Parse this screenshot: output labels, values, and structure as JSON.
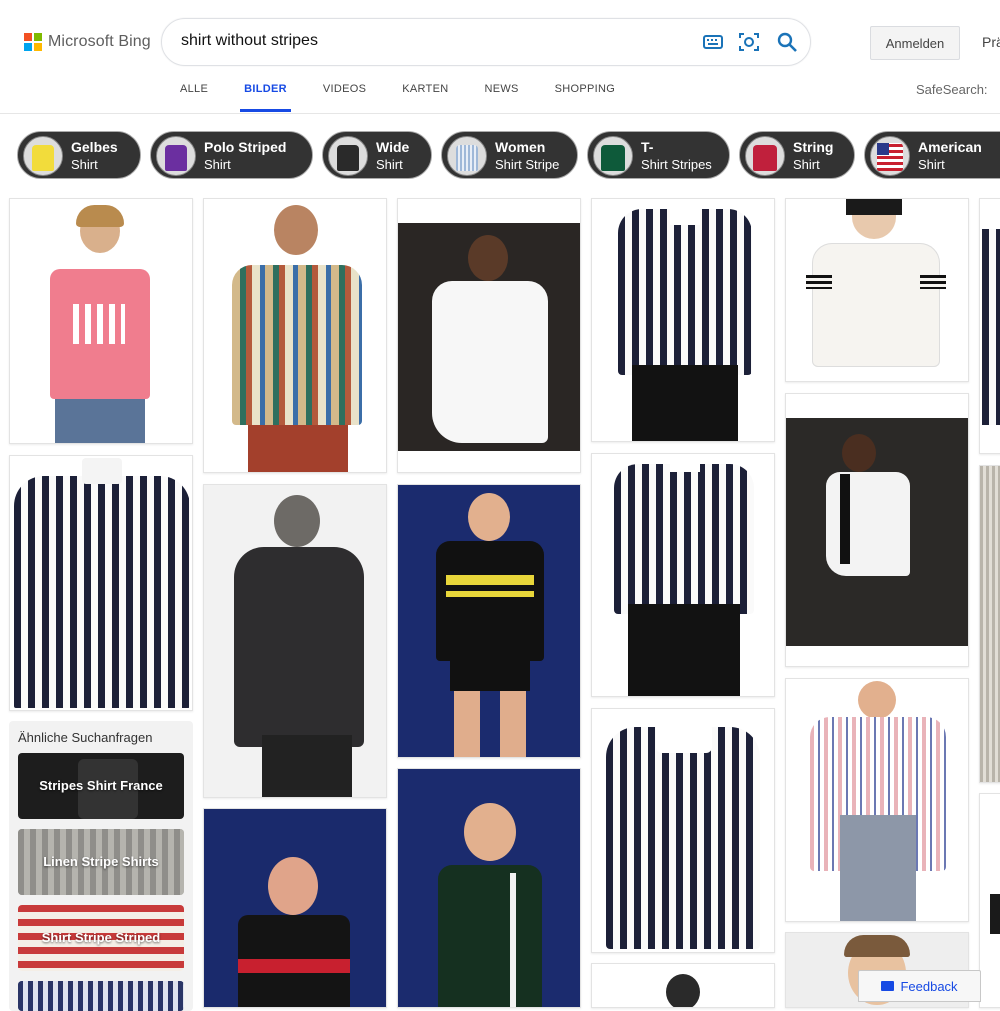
{
  "brand": {
    "name": "Microsoft Bing"
  },
  "search": {
    "query": "shirt without stripes"
  },
  "header": {
    "signin_label": "Anmelden",
    "pref_label": "Prä",
    "safesearch_label": "SafeSearch:"
  },
  "tabs": [
    "ALLE",
    "BILDER",
    "VIDEOS",
    "KARTEN",
    "NEWS",
    "SHOPPING"
  ],
  "chips": [
    {
      "line1": "Gelbes",
      "line2": "Shirt"
    },
    {
      "line1": "Polo Striped",
      "line2": "Shirt"
    },
    {
      "line1": "Wide",
      "line2": "Shirt"
    },
    {
      "line1": "Women",
      "line2": "Shirt Stripe"
    },
    {
      "line1": "T-",
      "line2": "Shirt Stripes"
    },
    {
      "line1": "String",
      "line2": "Shirt"
    },
    {
      "line1": "American",
      "line2": "Shirt"
    }
  ],
  "related": {
    "heading": "Ähnliche Suchanfragen",
    "items": [
      "Stripes Shirt France",
      "Linen Stripe Shirts",
      "Shirt Stripe Striped"
    ]
  },
  "feedback_label": "Feedback",
  "colors": {
    "accent": "#174ae4",
    "chip_bg": "#333333"
  }
}
